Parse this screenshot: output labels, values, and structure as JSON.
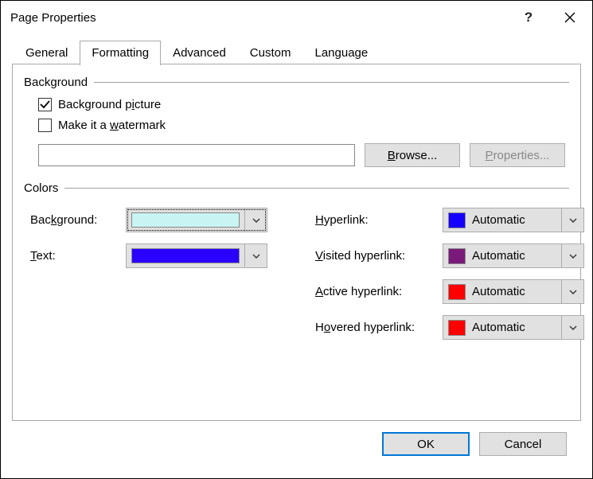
{
  "window": {
    "title": "Page Properties"
  },
  "tabs": {
    "general": "General",
    "formatting": "Formatting",
    "advanced": "Advanced",
    "custom": "Custom",
    "language": "Language",
    "active": "formatting"
  },
  "groups": {
    "background": "Background",
    "colors": "Colors"
  },
  "background": {
    "picture_label_pre": "Background p",
    "picture_label_u": "i",
    "picture_label_post": "cture",
    "picture_checked": true,
    "watermark_label_pre": "Make it a ",
    "watermark_label_u": "w",
    "watermark_label_post": "atermark",
    "watermark_checked": false,
    "path_value": "",
    "browse_u": "B",
    "browse_post": "rowse...",
    "properties_u": "P",
    "properties_post": "roperties...",
    "properties_enabled": false
  },
  "colors": {
    "background_label_pre": "Bac",
    "background_label_u": "k",
    "background_label_post": "ground:",
    "background_swatch": "#c8f4f4",
    "text_label_u": "T",
    "text_label_post": "ext:",
    "text_swatch": "#2a00ff",
    "hyperlink_label_u": "H",
    "hyperlink_label_post": "yperlink:",
    "hyperlink_swatch": "#1500ff",
    "hyperlink_text": "Automatic",
    "visited_label_u": "V",
    "visited_label_post": "isited hyperlink:",
    "visited_swatch": "#7a1a7a",
    "visited_text": "Automatic",
    "active_label_u": "A",
    "active_label_post": "ctive hyperlink:",
    "active_swatch": "#ff0000",
    "active_text": "Automatic",
    "hovered_label_pre": "H",
    "hovered_label_u": "o",
    "hovered_label_post": "vered hyperlink:",
    "hovered_swatch": "#ff0000",
    "hovered_text": "Automatic"
  },
  "footer": {
    "ok": "OK",
    "cancel": "Cancel"
  }
}
